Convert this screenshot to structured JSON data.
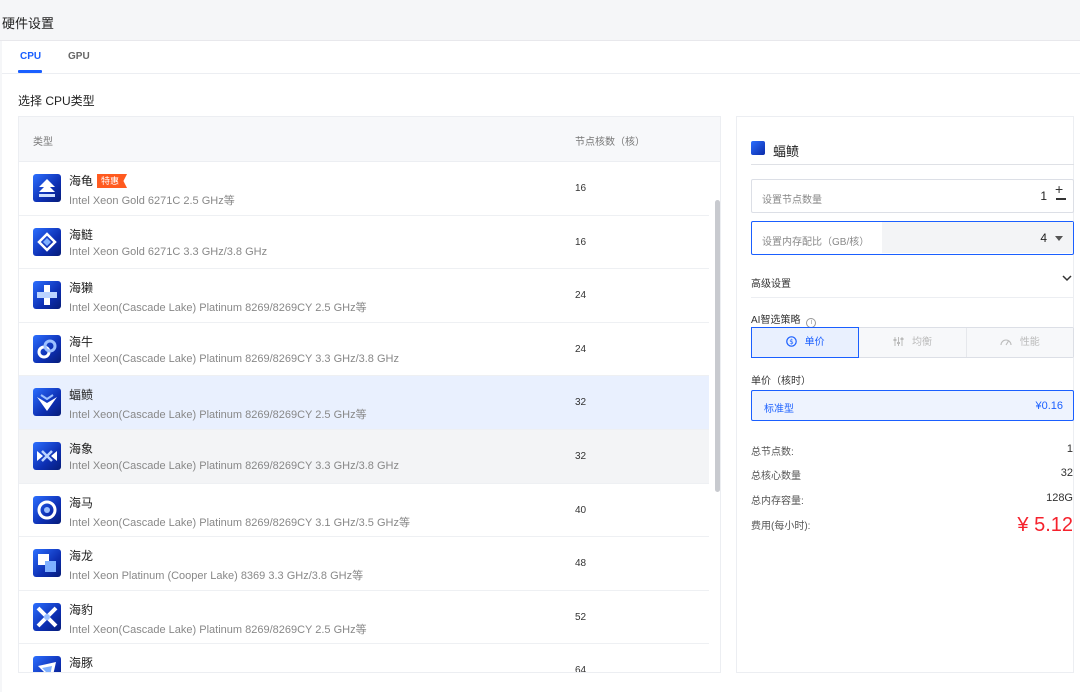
{
  "page": {
    "title": "硬件设置"
  },
  "tabs": [
    {
      "label": "CPU",
      "active": true
    },
    {
      "label": "GPU",
      "active": false
    }
  ],
  "section_title": "选择 CPU类型",
  "table": {
    "headers": {
      "type": "类型",
      "cores": "节点核数（核）"
    },
    "rows": [
      {
        "name": "海龟",
        "badge": "特惠",
        "desc": "Intel Xeon Gold 6271C 2.5 GHz等",
        "cores": "16",
        "icon": "turtle-icon"
      },
      {
        "name": "海鲢",
        "badge": "",
        "desc": "Intel Xeon Gold 6271C 3.3 GHz/3.8 GHz",
        "cores": "16",
        "icon": "tarpon-icon"
      },
      {
        "name": "海獭",
        "badge": "",
        "desc": "Intel Xeon(Cascade Lake) Platinum 8269/8269CY 2.5 GHz等",
        "cores": "24",
        "icon": "otter-icon"
      },
      {
        "name": "海牛",
        "badge": "",
        "desc": "Intel Xeon(Cascade Lake) Platinum 8269/8269CY 3.3 GHz/3.8 GHz",
        "cores": "24",
        "icon": "manatee-icon"
      },
      {
        "name": "蝠鲼",
        "badge": "",
        "desc": "Intel Xeon(Cascade Lake) Platinum 8269/8269CY 2.5 GHz等",
        "cores": "32",
        "icon": "manta-icon",
        "selected": true
      },
      {
        "name": "海象",
        "badge": "",
        "desc": "Intel Xeon(Cascade Lake) Platinum 8269/8269CY 3.3 GHz/3.8 GHz",
        "cores": "32",
        "icon": "walrus-icon",
        "hover": true
      },
      {
        "name": "海马",
        "badge": "",
        "desc": "Intel Xeon(Cascade Lake) Platinum 8269/8269CY 3.1 GHz/3.5 GHz等",
        "cores": "40",
        "icon": "seahorse-icon"
      },
      {
        "name": "海龙",
        "badge": "",
        "desc": "Intel Xeon Platinum (Cooper Lake) 8369 3.3 GHz/3.8 GHz等",
        "cores": "48",
        "icon": "seadragon-icon"
      },
      {
        "name": "海豹",
        "badge": "",
        "desc": "Intel Xeon(Cascade Lake) Platinum 8269/8269CY 2.5 GHz等",
        "cores": "52",
        "icon": "seal-icon"
      },
      {
        "name": "海豚",
        "badge": "",
        "desc": "",
        "cores": "64",
        "icon": "dolphin-icon"
      }
    ]
  },
  "panel": {
    "title": "蝠鲼",
    "node_count": {
      "label": "设置节点数量",
      "value": "1"
    },
    "memory_ratio": {
      "label": "设置内存配比（GB/核）",
      "value": "4"
    },
    "advanced_label": "高级设置",
    "strategy_label": "AI智选策略",
    "strategy_options": [
      {
        "label": "单价",
        "icon": "dollar-circle-icon",
        "active": true
      },
      {
        "label": "均衡",
        "icon": "sliders-icon",
        "active": false
      },
      {
        "label": "性能",
        "icon": "gauge-icon",
        "active": false
      }
    ],
    "unit_price_label": "单价（核时）",
    "unit_price": {
      "name": "标准型",
      "value": "¥0.16"
    },
    "summary": [
      {
        "label": "总节点数:",
        "value": "1"
      },
      {
        "label": "总核心数量",
        "value": "32"
      },
      {
        "label": "总内存容量:",
        "value": "128G"
      }
    ],
    "cost": {
      "label": "费用(每小时):",
      "value": "¥ 5.12"
    }
  },
  "colors": {
    "accent": "#1a5fff",
    "badge": "#ff5a1f",
    "cost": "#f5222d",
    "selected_row": "#e9f0fe"
  }
}
